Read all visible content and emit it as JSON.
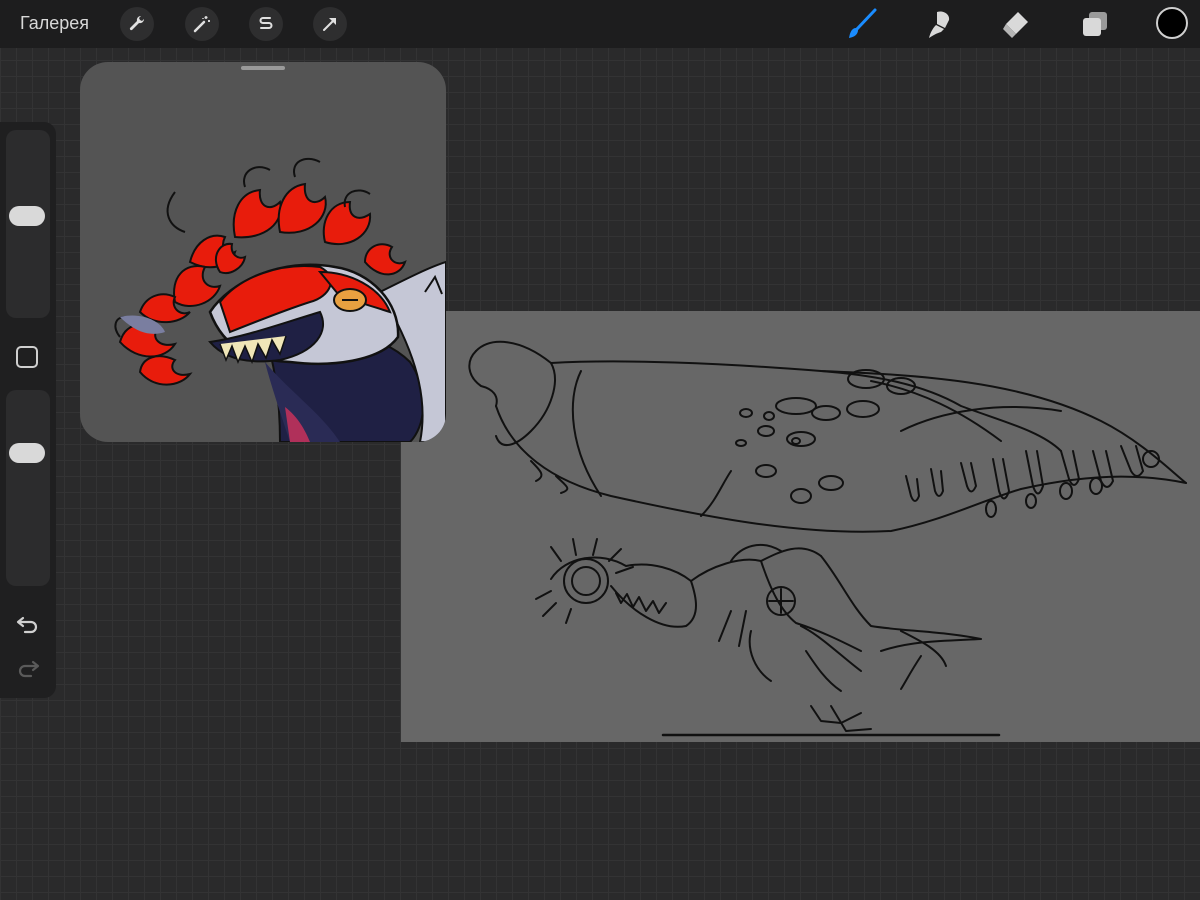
{
  "toolbar": {
    "gallery_label": "Галерея",
    "left_tools": [
      "wrench-icon",
      "magic-wand-icon",
      "selection-s-icon",
      "transform-arrow-icon"
    ],
    "right_tools": [
      "brush-icon",
      "smudge-icon",
      "eraser-icon",
      "layers-icon"
    ],
    "active_tool": "brush",
    "accent_color": "#1a8cff",
    "current_color": "#000000"
  },
  "sidebar": {
    "brush_size_level": 0.55,
    "opacity_level": 0.7,
    "icons": [
      "modify-square-icon",
      "undo-icon",
      "redo-icon"
    ]
  },
  "reference": {
    "label": "reference-window"
  },
  "canvas": {
    "background": "#676767"
  }
}
